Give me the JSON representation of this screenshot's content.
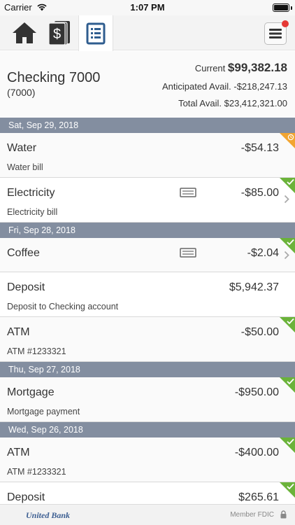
{
  "status_bar": {
    "carrier": "Carrier",
    "time": "1:07 PM"
  },
  "nav": {
    "tabs": [
      {
        "name": "home",
        "icon": "home-icon"
      },
      {
        "name": "money",
        "icon": "money-stack-icon"
      },
      {
        "name": "register",
        "icon": "register-list-icon",
        "active": true
      }
    ],
    "menu_icon": "hamburger-menu-icon",
    "notification_color": "#e53935"
  },
  "account": {
    "name": "Checking 7000",
    "number": "(7000)",
    "current_label": "Current",
    "current_value": "$99,382.18",
    "anticipated_label": "Anticipated Avail.",
    "anticipated_value": "-$218,247.13",
    "total_label": "Total Avail.",
    "total_value": "$23,412,321.00"
  },
  "sections": [
    {
      "date": "Sat, Sep 29, 2018",
      "transactions": [
        {
          "name": "Water",
          "amount": "-$54.13",
          "description": "Water bill",
          "status": "pending"
        },
        {
          "name": "Electricity",
          "amount": "-$85.00",
          "description": "Electricity bill",
          "status": "cleared",
          "memo": true
        }
      ]
    },
    {
      "date": "Fri, Sep 28, 2018",
      "transactions": [
        {
          "name": "Coffee",
          "amount": "-$2.04",
          "description": "",
          "status": "cleared",
          "memo": true
        },
        {
          "name": "Deposit",
          "amount": "$5,942.37",
          "description": "Deposit to Checking account",
          "status": "none"
        },
        {
          "name": "ATM",
          "amount": "-$50.00",
          "description": "ATM #1233321",
          "status": "cleared"
        }
      ]
    },
    {
      "date": "Thu, Sep 27, 2018",
      "transactions": [
        {
          "name": "Mortgage",
          "amount": "-$950.00",
          "description": "Mortgage payment",
          "status": "cleared"
        }
      ]
    },
    {
      "date": "Wed, Sep 26, 2018",
      "transactions": [
        {
          "name": "ATM",
          "amount": "-$400.00",
          "description": "ATM #1233321",
          "status": "cleared"
        },
        {
          "name": "Deposit",
          "amount": "$265.61",
          "description": "",
          "status": "cleared"
        }
      ]
    }
  ],
  "colors": {
    "date_header": "#838ea0",
    "cleared": "#6bb33a",
    "pending": "#f2a531",
    "register_icon": "#2f5d8f"
  },
  "footer": {
    "logo_text": "United Bank",
    "member_fdic": "Member FDIC"
  }
}
